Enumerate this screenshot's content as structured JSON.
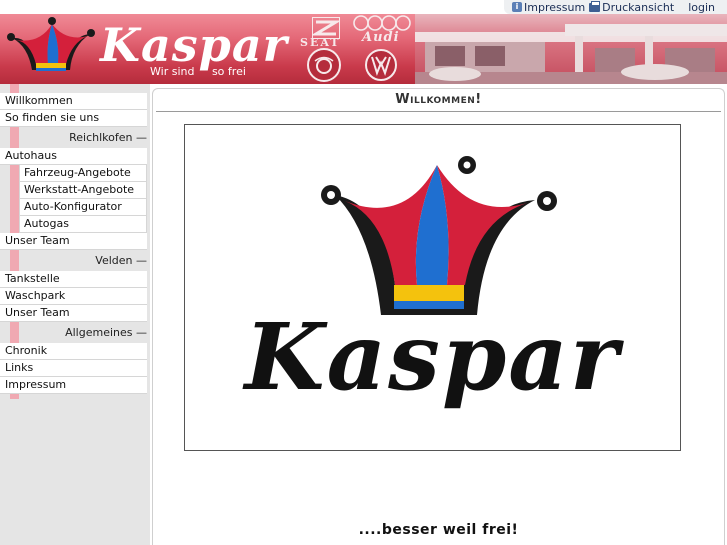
{
  "toplinks": {
    "impressum": "Impressum",
    "druckansicht": "Druckansicht",
    "login": "login"
  },
  "header": {
    "brand": "Kaspar",
    "slogan_left": "Wir sind",
    "slogan_right": "so frei",
    "brands": [
      "SEAT",
      "Audi",
      "ŠKODA",
      "VW"
    ]
  },
  "nav": {
    "willkommen": "Willkommen",
    "so_finden": "So finden sie uns",
    "section_reichlkofen": "Reichlkofen —",
    "autohaus": "Autohaus",
    "fahrzeug": "Fahrzeug-Angebote",
    "werkstatt": "Werkstatt-Angebote",
    "konfigurator": "Auto-Konfigurator",
    "autogas": "Autogas",
    "team1": "Unser Team",
    "section_velden": "Velden —",
    "tankstelle": "Tankstelle",
    "waschpark": "Waschpark",
    "team2": "Unser Team",
    "section_allgemeines": "Allgemeines —",
    "chronik": "Chronik",
    "links": "Links",
    "impressum": "Impressum"
  },
  "main": {
    "title": "Willkommen!",
    "logo_text": "Kaspar",
    "tagline": "....besser weil frei!"
  },
  "colors": {
    "header_red": "#c93a4b",
    "sidebar_bg": "#e5e5e5",
    "stripe_pink": "#f0a9b2",
    "jester_blue": "#1f6fd0",
    "jester_red": "#d4203b",
    "jester_yellow": "#f4c20d"
  }
}
